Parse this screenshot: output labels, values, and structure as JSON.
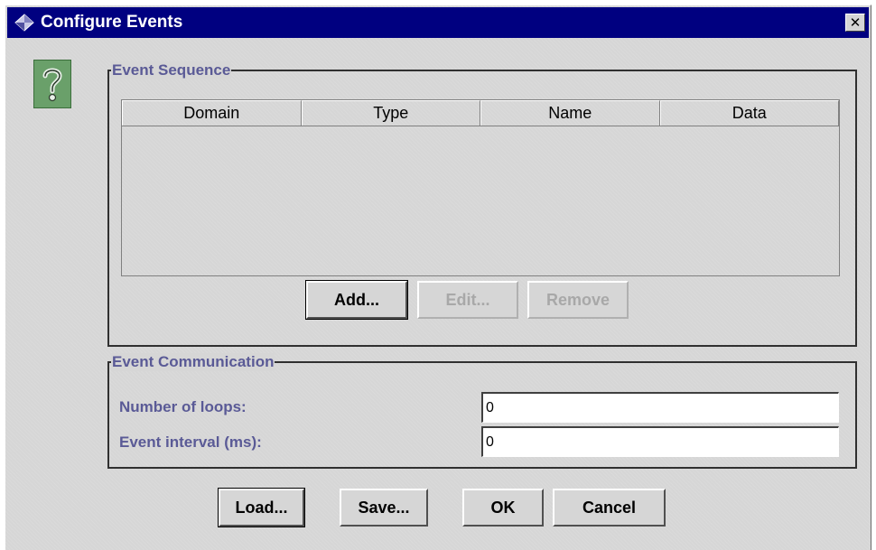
{
  "window": {
    "title": "Configure Events",
    "close_glyph": "✕"
  },
  "help": {
    "icon": "question-mark-icon"
  },
  "event_sequence": {
    "legend": "Event Sequence",
    "columns": [
      "Domain",
      "Type",
      "Name",
      "Data"
    ],
    "rows": [],
    "add_label": "Add...",
    "edit_label": "Edit...",
    "remove_label": "Remove"
  },
  "event_communication": {
    "legend": "Event Communication",
    "loops_label": "Number of loops:",
    "loops_value": "0",
    "interval_label": "Event interval (ms):",
    "interval_value": "0"
  },
  "footer": {
    "load_label": "Load...",
    "save_label": "Save...",
    "ok_label": "OK",
    "cancel_label": "Cancel"
  },
  "colors": {
    "title_bar": "#000080",
    "window_bg": "#d6d6d6",
    "label_text": "#5a5a96",
    "help_icon_bg": "#6aa06a"
  }
}
